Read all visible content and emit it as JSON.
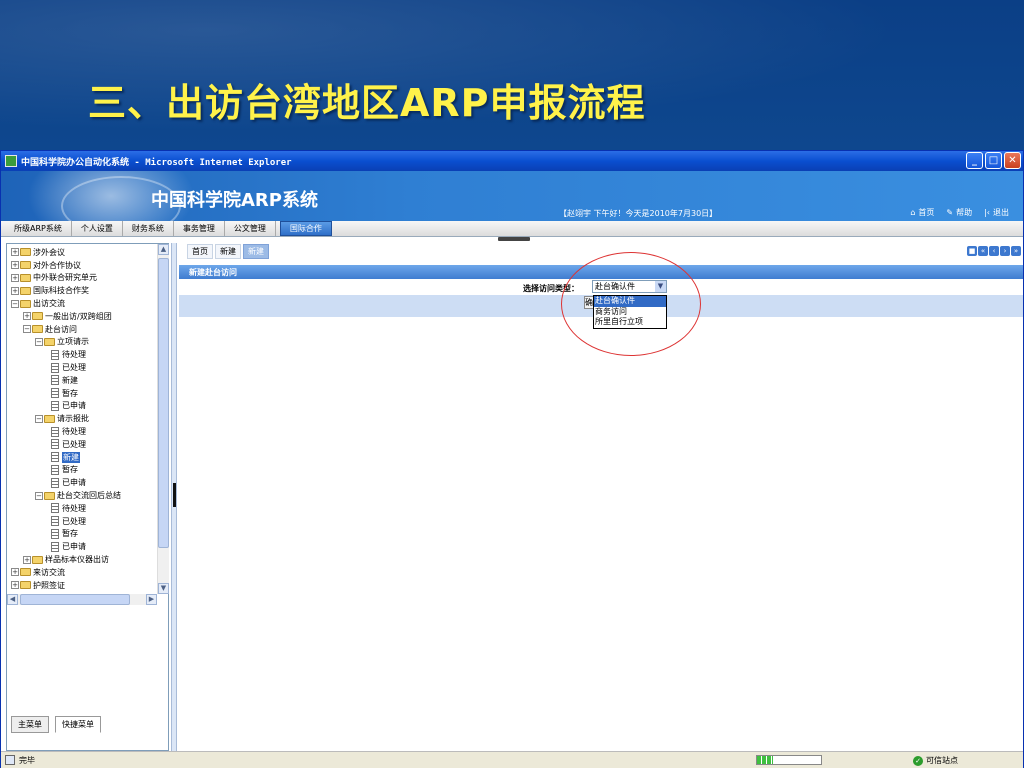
{
  "slide": {
    "title": "三、出访台湾地区ARP申报流程"
  },
  "window": {
    "title": "中国科学院办公自动化系统 - Microsoft Internet Explorer"
  },
  "banner": {
    "title": "中国科学院ARP系统",
    "greeting": "【赵翊宇 下午好！今天是2010年7月30日】",
    "links": [
      {
        "label": "首页",
        "icon": "home-icon"
      },
      {
        "label": "帮助",
        "icon": "help-icon"
      },
      {
        "label": "退出",
        "icon": "exit-icon"
      }
    ]
  },
  "menu": {
    "items": [
      "所级ARP系统",
      "个人设置",
      "财务系统",
      "事务管理",
      "公文管理",
      "国际合作"
    ],
    "active": "国际合作"
  },
  "tree": {
    "items": [
      {
        "label": "涉外会议",
        "indent": 0,
        "kind": "folder",
        "exp": "+"
      },
      {
        "label": "对外合作协议",
        "indent": 0,
        "kind": "folder",
        "exp": "+"
      },
      {
        "label": "中外联合研究单元",
        "indent": 0,
        "kind": "folder",
        "exp": "+"
      },
      {
        "label": "国际科技合作奖",
        "indent": 0,
        "kind": "folder",
        "exp": "+"
      },
      {
        "label": "出访交流",
        "indent": 0,
        "kind": "folder",
        "exp": "-"
      },
      {
        "label": "一般出访/双跨组团",
        "indent": 1,
        "kind": "folder",
        "exp": "+"
      },
      {
        "label": "赴台访问",
        "indent": 1,
        "kind": "folder",
        "exp": "-"
      },
      {
        "label": "立项请示",
        "indent": 2,
        "kind": "folder",
        "exp": "-"
      },
      {
        "label": "待处理",
        "indent": 3,
        "kind": "doc"
      },
      {
        "label": "已处理",
        "indent": 3,
        "kind": "doc"
      },
      {
        "label": "新建",
        "indent": 3,
        "kind": "doc"
      },
      {
        "label": "暂存",
        "indent": 3,
        "kind": "doc"
      },
      {
        "label": "已申请",
        "indent": 3,
        "kind": "doc"
      },
      {
        "label": "请示报批",
        "indent": 2,
        "kind": "folder",
        "exp": "-"
      },
      {
        "label": "待处理",
        "indent": 3,
        "kind": "doc"
      },
      {
        "label": "已处理",
        "indent": 3,
        "kind": "doc"
      },
      {
        "label": "新建",
        "indent": 3,
        "kind": "doc",
        "selected": true
      },
      {
        "label": "暂存",
        "indent": 3,
        "kind": "doc"
      },
      {
        "label": "已申请",
        "indent": 3,
        "kind": "doc"
      },
      {
        "label": "赴台交流回后总结",
        "indent": 2,
        "kind": "folder",
        "exp": "-"
      },
      {
        "label": "待处理",
        "indent": 3,
        "kind": "doc"
      },
      {
        "label": "已处理",
        "indent": 3,
        "kind": "doc"
      },
      {
        "label": "暂存",
        "indent": 3,
        "kind": "doc"
      },
      {
        "label": "已申请",
        "indent": 3,
        "kind": "doc"
      },
      {
        "label": "样品标本仪器出访",
        "indent": 1,
        "kind": "folder",
        "exp": "+"
      },
      {
        "label": "来访交流",
        "indent": 0,
        "kind": "folder",
        "exp": "+"
      },
      {
        "label": "护照签证",
        "indent": 0,
        "kind": "folder",
        "exp": "+"
      }
    ]
  },
  "bottom_tabs": {
    "main": "主菜单",
    "quick": "快捷菜单"
  },
  "content": {
    "tabs": [
      "首页",
      "新建",
      "新建"
    ],
    "section_title": "新建赴台访问",
    "form": {
      "label": "选择访问类型：",
      "selected": "赴台确认件",
      "confirm_label": "确定",
      "options": [
        "赴台确认件",
        "商务访问",
        "所里自行立项"
      ]
    }
  },
  "status": {
    "text": "完毕",
    "zone": "可信站点",
    "progress": 0.25
  },
  "colors": {
    "accent": "#316ac5",
    "title_yellow": "#fff24a",
    "annotation_red": "#dd3333"
  }
}
